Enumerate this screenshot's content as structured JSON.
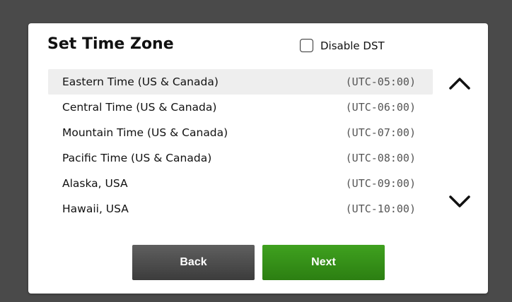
{
  "dialog": {
    "title": "Set Time Zone",
    "disable_dst": {
      "label": "Disable DST",
      "checked": false
    }
  },
  "timezones": [
    {
      "name": "Eastern Time (US & Canada)",
      "offset": "(UTC-05:00)",
      "selected": true
    },
    {
      "name": "Central Time (US & Canada)",
      "offset": "(UTC-06:00)",
      "selected": false
    },
    {
      "name": "Mountain Time (US & Canada)",
      "offset": "(UTC-07:00)",
      "selected": false
    },
    {
      "name": "Pacific Time (US & Canada)",
      "offset": "(UTC-08:00)",
      "selected": false
    },
    {
      "name": "Alaska, USA",
      "offset": "(UTC-09:00)",
      "selected": false
    },
    {
      "name": "Hawaii, USA",
      "offset": "(UTC-10:00)",
      "selected": false
    }
  ],
  "scroll": {
    "up_icon": "chevron-up-icon",
    "down_icon": "chevron-down-icon"
  },
  "buttons": {
    "back_label": "Back",
    "next_label": "Next"
  },
  "colors": {
    "next": "#2f8a14",
    "back": "#4a4a4a",
    "selected_row": "#eeeeee"
  }
}
